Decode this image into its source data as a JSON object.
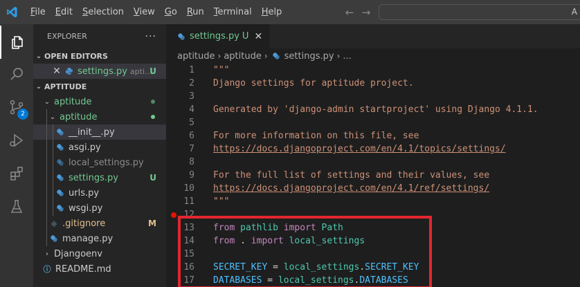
{
  "menu": {
    "items": [
      {
        "u": "F",
        "rest": "ile"
      },
      {
        "u": "E",
        "rest": "dit"
      },
      {
        "u": "S",
        "rest": "election"
      },
      {
        "u": "V",
        "rest": "iew"
      },
      {
        "u": "G",
        "rest": "o"
      },
      {
        "u": "R",
        "rest": "un"
      },
      {
        "u": "T",
        "rest": "erminal"
      },
      {
        "u": "H",
        "rest": "elp"
      }
    ],
    "search_text": "A"
  },
  "activity": {
    "scm_badge": "2"
  },
  "sidebar": {
    "title": "EXPLORER",
    "more": "···",
    "open_editors_label": "OPEN EDITORS",
    "open_editor": {
      "name": "settings.py",
      "desc": "apti...",
      "badge": "U"
    },
    "project_label": "APTITUDE",
    "tree": {
      "aptitude_outer": "aptitude",
      "aptitude_inner": "aptitude",
      "init": "__init__.py",
      "asgi": "asgi.py",
      "local_settings": "local_settings.py",
      "settings": "settings.py",
      "settings_badge": "U",
      "urls": "urls.py",
      "wsgi": "wsgi.py",
      "gitignore": ".gitignore",
      "gitignore_badge": "M",
      "manage": "manage.py",
      "djangoenv": "Djangoenv",
      "readme": "README.md"
    }
  },
  "editor": {
    "tab_name": "settings.py",
    "tab_badge": "U",
    "breadcrumb": [
      "aptitude",
      "aptitude",
      "settings.py",
      "..."
    ],
    "lines": [
      {
        "n": "1",
        "t": "\"\"\""
      },
      {
        "n": "2",
        "t": "Django settings for aptitude project."
      },
      {
        "n": "3",
        "t": ""
      },
      {
        "n": "4",
        "t": "Generated by 'django-admin startproject' using Django 4.1.1."
      },
      {
        "n": "5",
        "t": ""
      },
      {
        "n": "6",
        "t": "For more information on this file, see"
      },
      {
        "n": "7",
        "t": "https://docs.djangoproject.com/en/4.1/topics/settings/"
      },
      {
        "n": "8",
        "t": ""
      },
      {
        "n": "9",
        "t": "For the full list of settings and their values, see"
      },
      {
        "n": "10",
        "t": "https://docs.djangoproject.com/en/4.1/ref/settings/"
      },
      {
        "n": "11",
        "t": "\"\"\""
      },
      {
        "n": "12",
        "t": ""
      },
      {
        "n": "13",
        "a": "from",
        "b": " pathlib ",
        "c": "import",
        "d": " Path"
      },
      {
        "n": "14",
        "a": "from",
        "b": " . ",
        "c": "import",
        "d": " local_settings"
      },
      {
        "n": "15",
        "t": ""
      },
      {
        "n": "16",
        "a": "SECRET_KEY",
        "b": " = ",
        "c": "local_settings",
        "d": ".",
        "e": "SECRET_KEY"
      },
      {
        "n": "17",
        "a": "DATABASES",
        "b": " = ",
        "c": "local_settings",
        "d": ".",
        "e": "DATABASES"
      }
    ]
  },
  "colors": {
    "accent": "#0078d4",
    "untracked": "#73c991",
    "modified": "#e2c08d",
    "highlight": "#e3262f"
  }
}
